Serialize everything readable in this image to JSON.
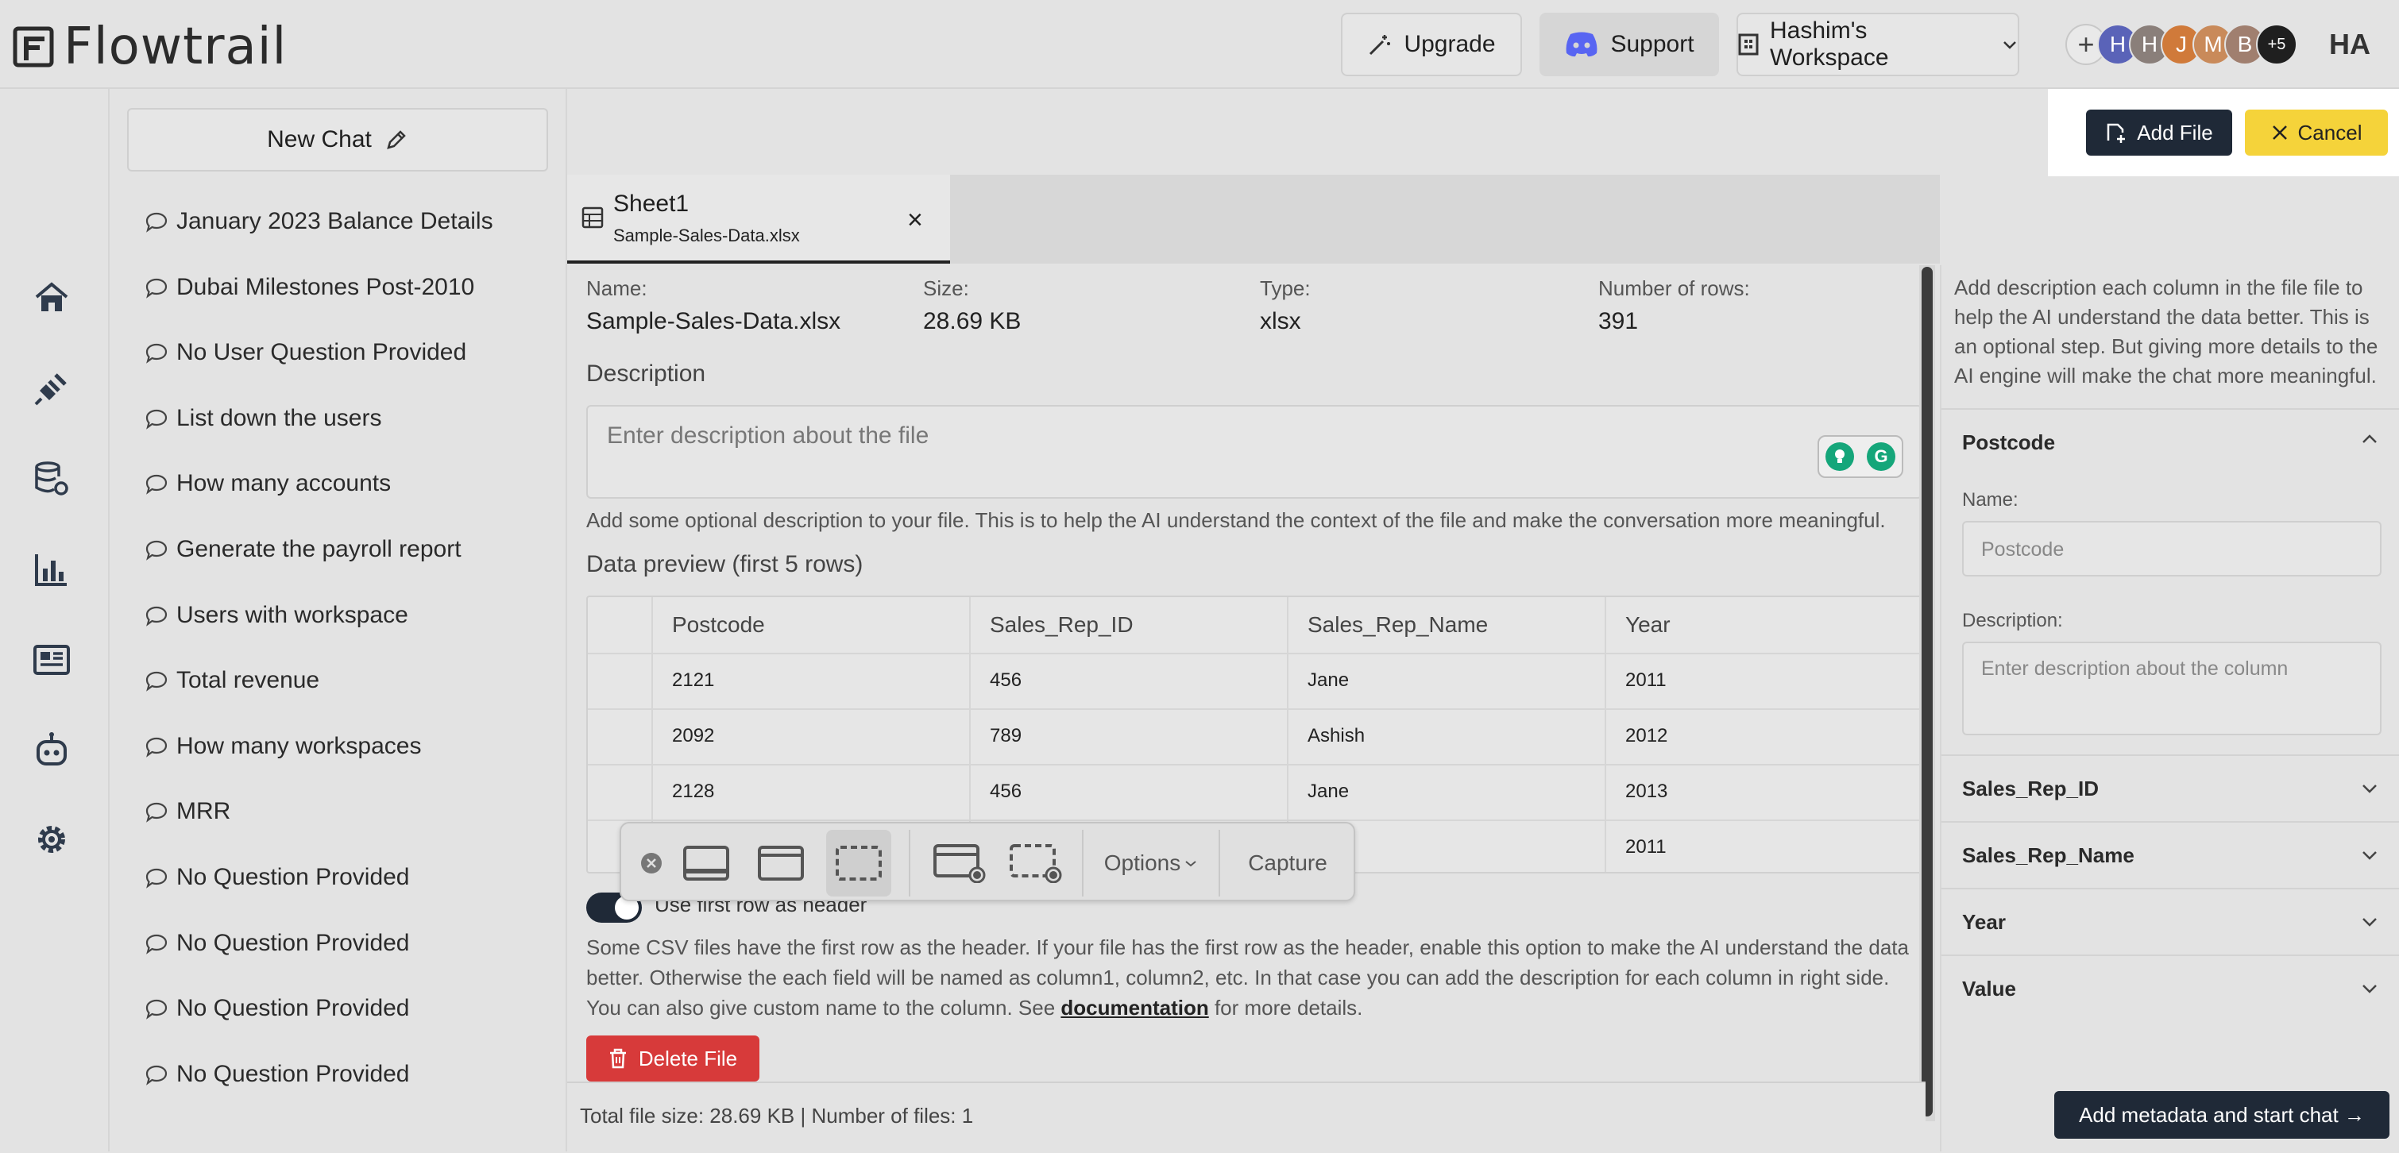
{
  "app": {
    "name": "Flowtrail"
  },
  "topbar": {
    "upgrade_label": "Upgrade",
    "support_label": "Support",
    "workspace_label": "Hashim's Workspace",
    "avatars": [
      "H",
      "H",
      "J",
      "M",
      "B"
    ],
    "avatar_more": "+5",
    "avatar_add": "+",
    "user_initials": "HA",
    "avatar_colors": [
      "#5a63b8",
      "#8a7f7a",
      "#d07a3a",
      "#c98a5a",
      "#a07f6f"
    ]
  },
  "sidebar": {
    "rail_icons": [
      "home-icon",
      "plug-icon",
      "database-settings-icon",
      "chart-icon",
      "report-icon",
      "robot-icon",
      "settings-icon"
    ],
    "new_chat_label": "New Chat",
    "chats": [
      "January 2023 Balance Details",
      "Dubai Milestones Post-2010",
      "No User Question Provided",
      "List down the users",
      "How many accounts",
      "Generate the payroll report",
      "Users with workspace",
      "Total revenue",
      "How many workspaces",
      "MRR",
      "No Question Provided",
      "No Question Provided",
      "No Question Provided",
      "No Question Provided"
    ]
  },
  "actions": {
    "add_file_label": "Add File",
    "cancel_label": "Cancel"
  },
  "tab": {
    "name": "Sheet1",
    "file": "Sample-Sales-Data.xlsx",
    "close": "×"
  },
  "file_meta": {
    "name_label": "Name:",
    "name_value": "Sample-Sales-Data.xlsx",
    "size_label": "Size:",
    "size_value": "28.69 KB",
    "type_label": "Type:",
    "type_value": "xlsx",
    "rows_label": "Number of rows:",
    "rows_value": "391"
  },
  "description": {
    "title": "Description",
    "placeholder": "Enter description about the file",
    "help": "Add some optional description to your file. This is to help the AI understand the context of the file and make the conversation more meaningful."
  },
  "preview": {
    "title": "Data preview (first 5 rows)",
    "columns": [
      "Postcode",
      "Sales_Rep_ID",
      "Sales_Rep_Name",
      "Year"
    ],
    "rows": [
      [
        "2121",
        "456",
        "Jane",
        "2011"
      ],
      [
        "2092",
        "789",
        "Ashish",
        "2012"
      ],
      [
        "2128",
        "456",
        "Jane",
        "2013"
      ],
      [
        "",
        "",
        "",
        "2011"
      ]
    ]
  },
  "capture_toolbar": {
    "options_label": "Options",
    "capture_label": "Capture"
  },
  "header_option": {
    "label": "Use first row as header",
    "help_before": "Some CSV files have the first row as the header. If your file has the first row as the header, enable this option to make the AI understand the data better. Otherwise the each field will be named as column1, column2, etc. In that case you can add the description for each column in right side. You can also give custom name to the column. See ",
    "help_link": "documentation",
    "help_after": " for more details."
  },
  "delete_label": "Delete File",
  "footer": {
    "summary": "Total file size: 28.69 KB | Number of files: 1"
  },
  "right_panel": {
    "intro": "Add description each column in the file file to help the AI understand the data better. This is an optional step. But giving more details to the AI engine will make the chat more meaningful.",
    "expanded": {
      "title": "Postcode",
      "name_label": "Name:",
      "name_placeholder": "Postcode",
      "desc_label": "Description:",
      "desc_placeholder": "Enter description about the column"
    },
    "collapsed": [
      "Sales_Rep_ID",
      "Sales_Rep_Name",
      "Year",
      "Value"
    ],
    "start_label": "Add metadata and start chat →"
  }
}
